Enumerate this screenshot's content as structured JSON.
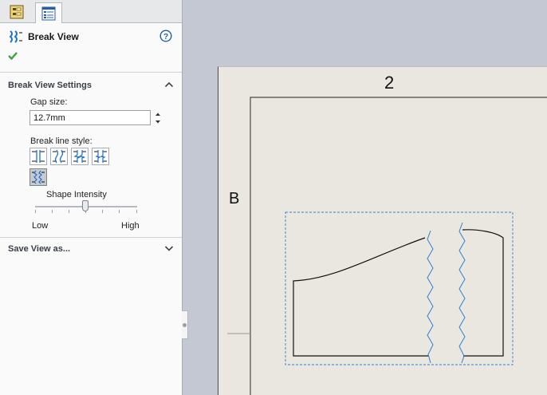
{
  "tabs": [
    {
      "name": "feature-manager",
      "icon": "feature-tree-icon"
    },
    {
      "name": "property-manager",
      "icon": "property-manager-icon"
    }
  ],
  "panel": {
    "title": "Break View",
    "title_icon": "break-view-icon",
    "help_icon": "help-icon",
    "ok_icon": "checkmark-icon"
  },
  "settings": {
    "header": "Break View Settings",
    "gap_label": "Gap size:",
    "gap_value": "12.7mm",
    "style_label": "Break line style:",
    "styles": [
      "straight-cut",
      "curve-cut",
      "zig-zag-cut",
      "small-zig-zag-cut",
      "jagged-cut"
    ],
    "selected_style": "jagged-cut",
    "intensity_label": "Shape Intensity",
    "intensity_value": 0.5,
    "low_label": "Low",
    "high_label": "High"
  },
  "save_section": {
    "header": "Save View as..."
  },
  "drawing": {
    "zone_column": "2",
    "zone_row": "B"
  },
  "colors": {
    "panel_bg": "#fafafa",
    "sheet_bg": "#e9e7e0",
    "workspace_bg": "#c4c8d2",
    "break_line": "#2f7fd4",
    "accent_icon": "#1e73c8",
    "ok_green": "#3aa33a"
  }
}
